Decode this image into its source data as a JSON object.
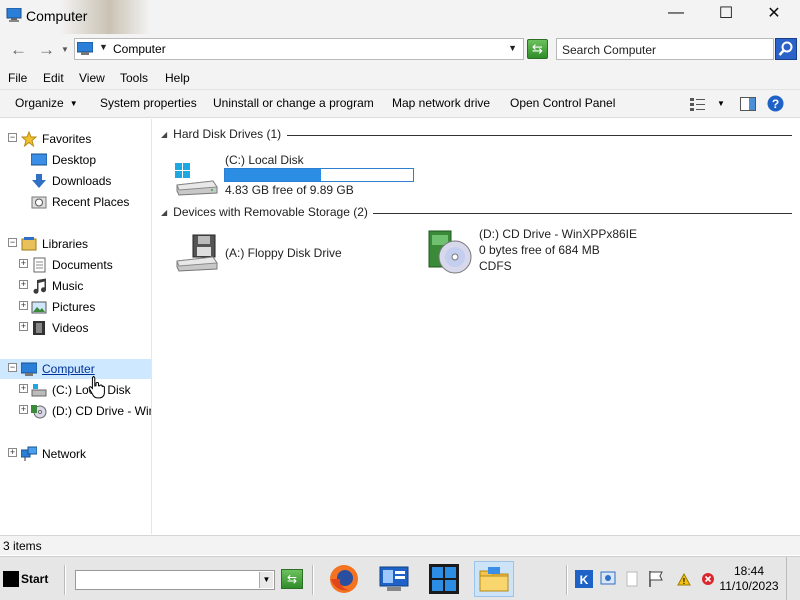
{
  "window": {
    "title": "Computer",
    "minimize": "—",
    "maximize": "☐",
    "close": "✕"
  },
  "address": {
    "back": "←",
    "forward": "→",
    "crumb": "Computer",
    "search_placeholder": "Search Computer"
  },
  "menu": {
    "file": "File",
    "edit": "Edit",
    "view": "View",
    "tools": "Tools",
    "help": "Help"
  },
  "commands": {
    "organize": "Organize",
    "system_properties": "System properties",
    "uninstall": "Uninstall or change a program",
    "map_drive": "Map network drive",
    "control_panel": "Open Control Panel"
  },
  "nav": {
    "favorites": "Favorites",
    "desktop": "Desktop",
    "downloads": "Downloads",
    "recent": "Recent Places",
    "libraries": "Libraries",
    "documents": "Documents",
    "music": "Music",
    "pictures": "Pictures",
    "videos": "Videos",
    "computer": "Computer",
    "local_disk": "(C:) Local Disk",
    "cd_drive": "(D:) CD Drive - Win",
    "network": "Network"
  },
  "content": {
    "hdd_group": "Hard Disk Drives (1)",
    "removable_group": "Devices with Removable Storage (2)",
    "c_drive": {
      "name": "(C:) Local Disk",
      "free": "4.83 GB free of 9.89 GB",
      "used_fraction": 0.51
    },
    "floppy": {
      "name": "(A:) Floppy Disk Drive"
    },
    "d_drive": {
      "name": "(D:) CD Drive - WinXPPx86IE",
      "free": "0 bytes free of 684 MB",
      "fs": "CDFS"
    }
  },
  "status": {
    "items": "3 items"
  },
  "taskbar": {
    "start": "Start",
    "time": "18:44",
    "date": "11/10/2023"
  }
}
